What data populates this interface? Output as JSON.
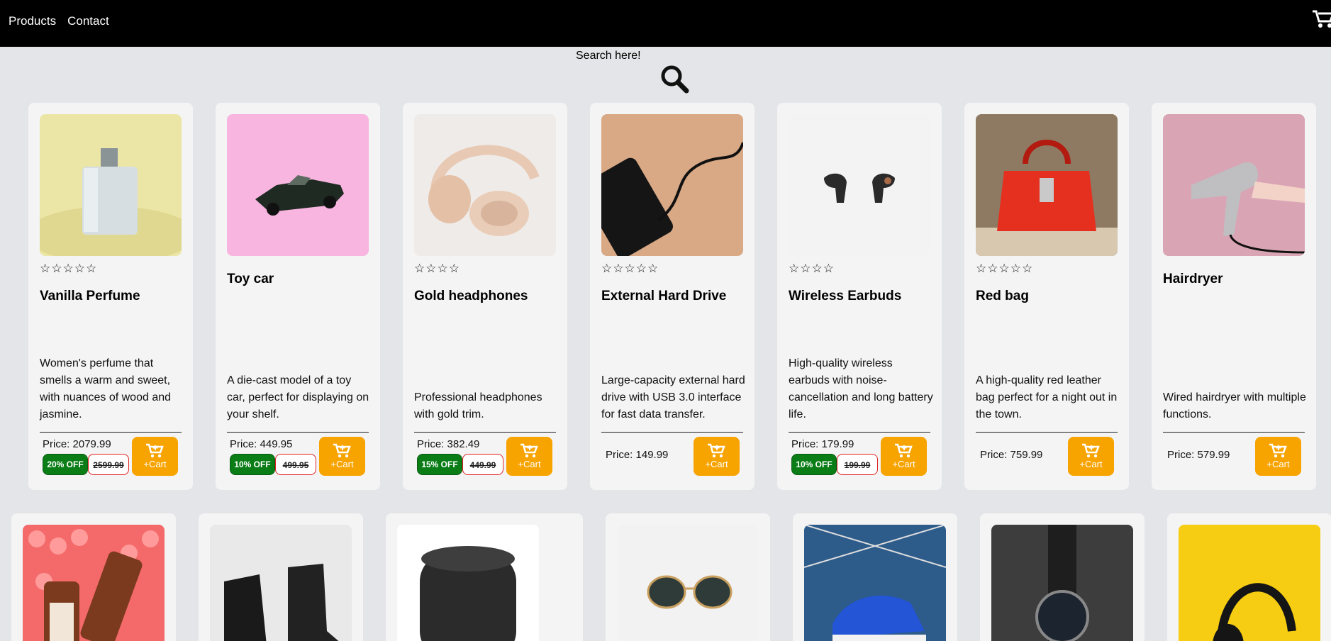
{
  "nav": {
    "products": "Products",
    "contact": "Contact"
  },
  "search": {
    "label": "Search here!"
  },
  "colors": {
    "topbar": "#000000",
    "background": "#e4e5e8",
    "card": "#f4f4f4",
    "cart_button": "#f7a300",
    "discount_badge": "#0a7d17",
    "old_price_border": "#e02020"
  },
  "products": [
    {
      "title": "Vanilla Perfume",
      "rating": "☆☆☆☆☆",
      "description": "Women's perfume that smells a warm and sweet, with nuances of wood and jasmine.",
      "price": "Price: 2079.99",
      "discount": "20% OFF",
      "old_price": "2599.99",
      "cart_label": "+Cart",
      "image_icon": "perfume-image"
    },
    {
      "title": "Toy car",
      "rating": "",
      "description": "A die-cast model of a toy car, perfect for displaying on your shelf.",
      "price": "Price: 449.95",
      "discount": "10% OFF",
      "old_price": "499.95",
      "cart_label": "+Cart",
      "image_icon": "toy-car-image"
    },
    {
      "title": "Gold headphones",
      "rating": "☆☆☆☆",
      "description": "Professional headphones with gold trim.",
      "price": "Price: 382.49",
      "discount": "15% OFF",
      "old_price": "449.99",
      "cart_label": "+Cart",
      "image_icon": "headphones-image"
    },
    {
      "title": "External Hard Drive",
      "rating": "☆☆☆☆☆",
      "description": "Large-capacity external hard drive with USB 3.0 interface for fast data transfer.",
      "price": "Price: 149.99",
      "discount": "",
      "old_price": "",
      "cart_label": "+Cart",
      "image_icon": "hard-drive-image"
    },
    {
      "title": "Wireless Earbuds",
      "rating": "☆☆☆☆",
      "description": "High-quality wireless earbuds with noise-cancellation and long battery life.",
      "price": "Price: 179.99",
      "discount": "10% OFF",
      "old_price": "199.99",
      "cart_label": "+Cart",
      "image_icon": "earbuds-image"
    },
    {
      "title": "Red bag",
      "rating": "☆☆☆☆☆",
      "description": "A high-quality red leather bag perfect for a night out in the town.",
      "price": "Price: 759.99",
      "discount": "",
      "old_price": "",
      "cart_label": "+Cart",
      "image_icon": "red-bag-image"
    },
    {
      "title": "Hairdryer",
      "rating": "",
      "description": "Wired hairdryer with multiple functions.",
      "price": "Price: 579.99",
      "discount": "",
      "old_price": "",
      "cart_label": "+Cart",
      "image_icon": "hairdryer-image"
    }
  ],
  "second_row_images": [
    "serum-image",
    "boots-image",
    "speaker-image",
    "sunglasses-image",
    "sneaker-image",
    "watch-image",
    "black-headphones-image"
  ]
}
